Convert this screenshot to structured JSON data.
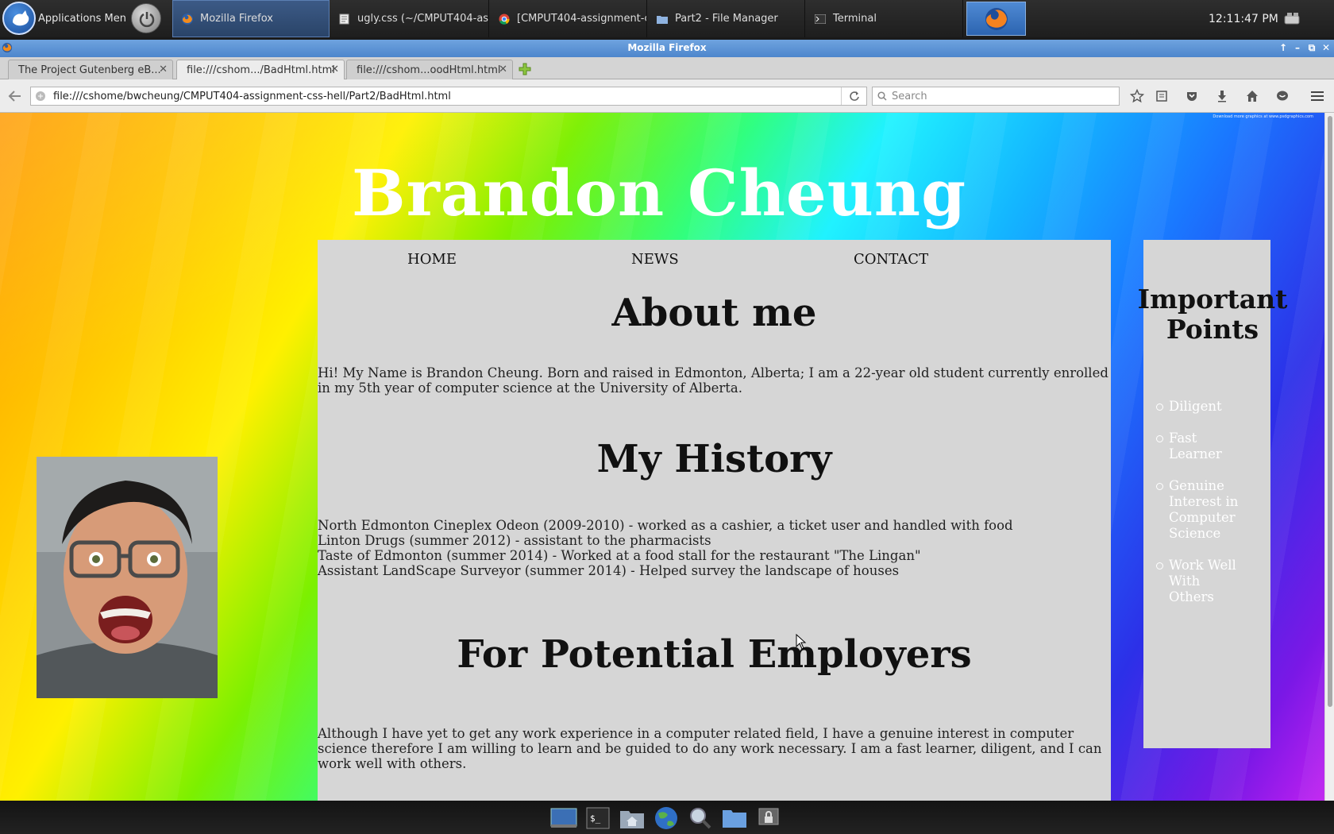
{
  "panel": {
    "app_menu_label": "Applications Menu",
    "tasks": [
      {
        "label": "Mozilla Firefox",
        "icon": "firefox-icon",
        "active": true
      },
      {
        "label": "ugly.css (~/CMPUT404-ass...",
        "icon": "text-editor-icon",
        "active": false
      },
      {
        "label": "[CMPUT404-assignment-c...",
        "icon": "chrome-icon",
        "active": false
      },
      {
        "label": "Part2 - File Manager",
        "icon": "folder-icon",
        "active": false
      },
      {
        "label": "Terminal",
        "icon": "terminal-icon",
        "active": false
      }
    ],
    "clock": "12:11:47 PM"
  },
  "window": {
    "title": "Mozilla Firefox"
  },
  "browser": {
    "tabs": [
      {
        "label": "The Project Gutenberg eB...",
        "selected": false
      },
      {
        "label": "file:///cshom.../BadHtml.html",
        "selected": true
      },
      {
        "label": "file:///cshom...oodHtml.html",
        "selected": false
      }
    ],
    "url": "file:///cshome/bwcheung/CMPUT404-assignment-css-hell/Part2/BadHtml.html",
    "search_placeholder": "Search"
  },
  "page": {
    "background_credit": "Download more graphics at www.psdgraphics.com",
    "site_title": "Brandon Cheung",
    "menu": [
      "HOME",
      "NEWS",
      "CONTACT"
    ],
    "about": {
      "heading": "About me",
      "text": "Hi! My Name is Brandon Cheung. Born and raised in Edmonton, Alberta; I am a 22-year old student currently enrolled in my 5th year of computer science at the University of Alberta."
    },
    "history": {
      "heading": "My History",
      "items": [
        "North Edmonton Cineplex Odeon (2009-2010) - worked as a cashier, a ticket user and handled with food",
        "Linton Drugs (summer 2012) - assistant to the pharmacists",
        "Taste of Edmonton (summer 2014) - Worked at a food stall for the restaurant \"The Lingan\"",
        "Assistant LandScape Surveyor (summer 2014) - Helped survey the landscape of houses"
      ]
    },
    "employers": {
      "heading": "For Potential Employers",
      "text": "Although I have yet to get any work experience in a computer related field, I have a genuine interest in computer science therefore I am willing to learn and be guided to do any work necessary. I am a fast learner, diligent, and I can work well with others."
    },
    "sidebar": {
      "title": "Important Points",
      "points": [
        "Diligent",
        "Fast Learner",
        "Genuine Interest in Computer Science",
        "Work Well With Others"
      ]
    }
  },
  "colors": {
    "panel_bg": "#1e1e1e",
    "title_bar": "#4d86cc",
    "content_panel": "#d6d6d6"
  }
}
